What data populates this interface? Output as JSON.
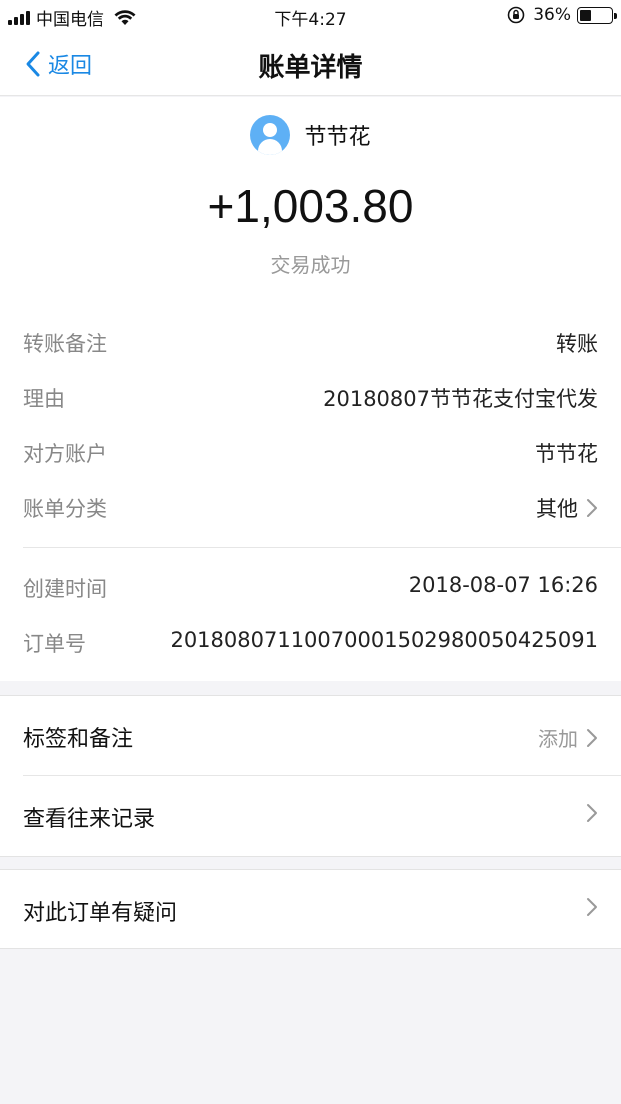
{
  "status_bar": {
    "carrier": "中国电信",
    "time": "下午4:27",
    "battery_percent": "36%",
    "battery_level": 0.36,
    "icons": [
      "signal-icon",
      "wifi-icon",
      "rotation-lock-icon",
      "battery-icon"
    ]
  },
  "nav": {
    "back_label": "返回",
    "title": "账单详情"
  },
  "payee": {
    "name": "节节花",
    "avatar_icon": "user-avatar-icon",
    "avatar_color": "#5eb0f5"
  },
  "transaction": {
    "amount": "+1,003.80",
    "status": "交易成功"
  },
  "details": [
    {
      "label": "转账备注",
      "value": "转账"
    },
    {
      "label": "理由",
      "value": "20180807节节花支付宝代发"
    },
    {
      "label": "对方账户",
      "value": "节节花"
    },
    {
      "label": "账单分类",
      "value": "其他"
    }
  ],
  "meta": [
    {
      "label": "创建时间",
      "value": "2018-08-07 16:26"
    },
    {
      "label": "订单号",
      "value": "2018080711007000150298005042509​1"
    }
  ],
  "actions_group1": [
    {
      "label": "标签和备注",
      "right_text": "添加"
    },
    {
      "label": "查看往来记录",
      "right_text": ""
    }
  ],
  "actions_group2": [
    {
      "label": "对此订单有疑问",
      "right_text": ""
    }
  ],
  "colors": {
    "accent": "#1a88e4",
    "background": "#f4f4f7"
  }
}
